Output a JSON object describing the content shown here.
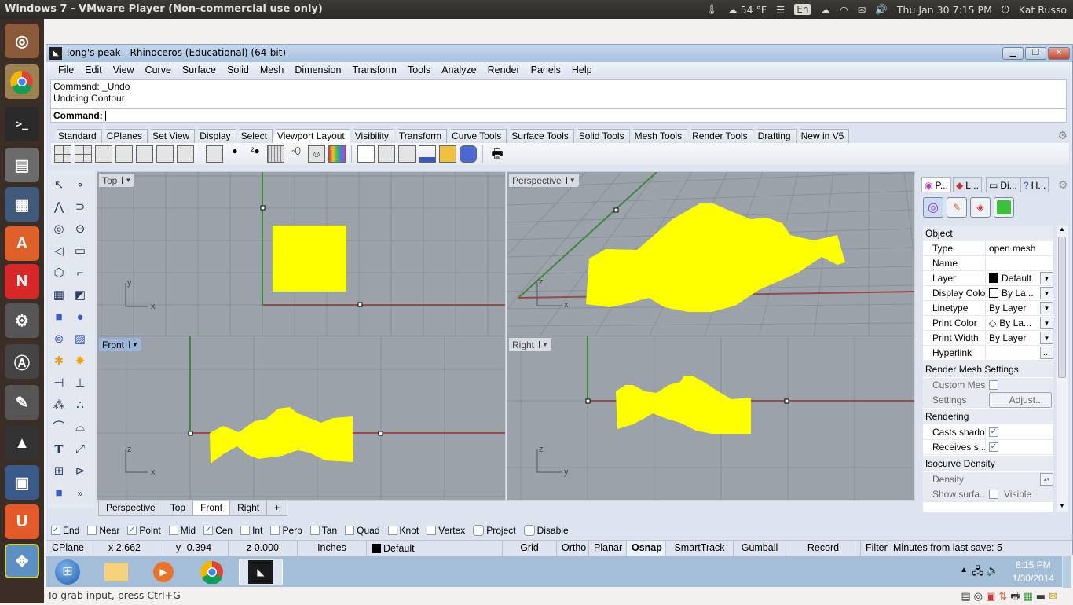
{
  "os_topbar": {
    "window_title": "Windows 7 - VMware Player (Non-commercial use only)",
    "weather": "54 °F",
    "keyboard_layout": "En",
    "datetime": "Thu Jan 30  7:15 PM",
    "user": "Kat Russo"
  },
  "launcher": {
    "items": [
      "Ubuntu Dash",
      "Chrome",
      "Terminal",
      "Files",
      "LibreOffice Impress",
      "Ubuntu Software Center",
      "Netflix",
      "System Settings",
      "Update Manager",
      "GIMP",
      "Inkscape",
      "Shotwell",
      "Ubuntu One",
      "VMware Player"
    ]
  },
  "rhino": {
    "title": "long's peak - Rhinoceros (Educational) (64-bit)",
    "menu": [
      "File",
      "Edit",
      "View",
      "Curve",
      "Surface",
      "Solid",
      "Mesh",
      "Dimension",
      "Transform",
      "Tools",
      "Analyze",
      "Render",
      "Panels",
      "Help"
    ],
    "command_history": [
      "Command: _Undo",
      "Undoing Contour"
    ],
    "command_prompt": "Command:",
    "toolbar_tabs": [
      "Standard",
      "CPlanes",
      "Set View",
      "Display",
      "Select",
      "Viewport Layout",
      "Visibility",
      "Transform",
      "Curve Tools",
      "Surface Tools",
      "Solid Tools",
      "Mesh Tools",
      "Render Tools",
      "Drafting",
      "New in V5"
    ],
    "active_toolbar_tab": "Viewport Layout",
    "viewports": {
      "top": {
        "label": "Top"
      },
      "perspective": {
        "label": "Perspective"
      },
      "front": {
        "label": "Front"
      },
      "right": {
        "label": "Right"
      }
    },
    "viewport_tabs": [
      "Perspective",
      "Top",
      "Front",
      "Right"
    ],
    "active_viewport_tab": "Front",
    "osnap": [
      {
        "label": "End",
        "checked": true
      },
      {
        "label": "Near",
        "checked": false
      },
      {
        "label": "Point",
        "checked": true
      },
      {
        "label": "Mid",
        "checked": false
      },
      {
        "label": "Cen",
        "checked": true
      },
      {
        "label": "Int",
        "checked": false
      },
      {
        "label": "Perp",
        "checked": false
      },
      {
        "label": "Tan",
        "checked": false
      },
      {
        "label": "Quad",
        "checked": false
      },
      {
        "label": "Knot",
        "checked": false
      },
      {
        "label": "Vertex",
        "checked": false
      },
      {
        "label": "Project",
        "checked": false
      },
      {
        "label": "Disable",
        "checked": false
      }
    ],
    "status": {
      "cplane": "CPlane",
      "x": "x 2.662",
      "y": "y -0.394",
      "z": "z 0.000",
      "units": "Inches",
      "layer": "Default",
      "grid_snap": "Grid Snap",
      "ortho": "Ortho",
      "planar": "Planar",
      "osnap": "Osnap",
      "smarttrack": "SmartTrack",
      "gumball": "Gumball",
      "record_history": "Record History",
      "filter": "Filter",
      "last_save": "Minutes from last save: 5"
    },
    "panel": {
      "tabs": [
        "P...",
        "L...",
        "Di...",
        "H..."
      ],
      "section_object": "Object",
      "rows": [
        {
          "key": "Type",
          "value": "open mesh"
        },
        {
          "key": "Name",
          "value": ""
        },
        {
          "key": "Layer",
          "value": "Default"
        },
        {
          "key": "Display Color",
          "value": "By La..."
        },
        {
          "key": "Linetype",
          "value": "By Layer"
        },
        {
          "key": "Print Color",
          "value": "By La..."
        },
        {
          "key": "Print Width",
          "value": "By Layer"
        },
        {
          "key": "Hyperlink",
          "value": ""
        }
      ],
      "section_render_mesh": "Render Mesh Settings",
      "custom_mesh": "Custom Mesh",
      "settings": "Settings",
      "adjust": "Adjust...",
      "section_rendering": "Rendering",
      "casts_shadows": "Casts shado...",
      "receives_shadows": "Receives s...",
      "casts_checked": true,
      "receives_checked": true,
      "section_isocurve": "Isocurve Density",
      "density": "Density",
      "show_surface": "Show surfa...",
      "visible": "Visible"
    }
  },
  "win_taskbar": {
    "time": "8:15 PM",
    "date": "1/30/2014"
  },
  "vm_status": "To grab input, press Ctrl+G",
  "colors": {
    "mesh": "#ffff00",
    "viewport_bg": "#9ba2aa",
    "x_axis": "#9b4a44",
    "y_axis": "#3d8a3d"
  }
}
